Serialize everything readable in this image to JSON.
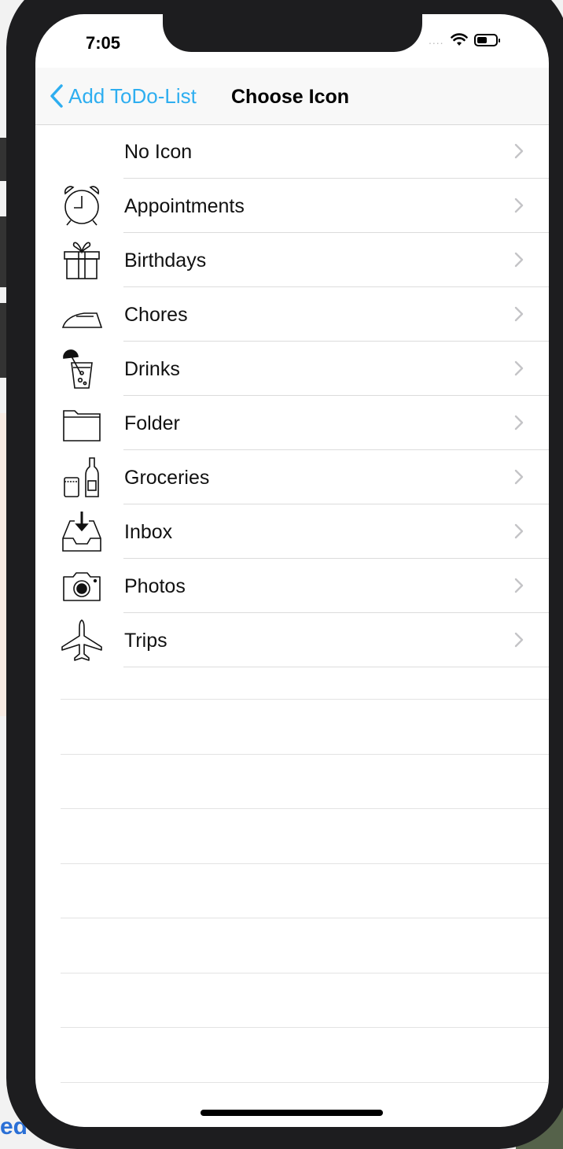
{
  "status_bar": {
    "time": "7:05",
    "signal": "....",
    "icons": [
      "wifi-icon",
      "battery-icon"
    ]
  },
  "nav": {
    "back_label": "Add ToDo-List",
    "title": "Choose Icon",
    "accent_color": "#2eaef0"
  },
  "icons_list": [
    {
      "label": "No Icon",
      "icon": "none"
    },
    {
      "label": "Appointments",
      "icon": "alarm-clock-icon"
    },
    {
      "label": "Birthdays",
      "icon": "gift-icon"
    },
    {
      "label": "Chores",
      "icon": "iron-icon"
    },
    {
      "label": "Drinks",
      "icon": "drink-icon"
    },
    {
      "label": "Folder",
      "icon": "folder-icon"
    },
    {
      "label": "Groceries",
      "icon": "groceries-icon"
    },
    {
      "label": "Inbox",
      "icon": "inbox-icon"
    },
    {
      "label": "Photos",
      "icon": "camera-icon"
    },
    {
      "label": "Trips",
      "icon": "airplane-icon"
    }
  ],
  "background_text": "ed"
}
